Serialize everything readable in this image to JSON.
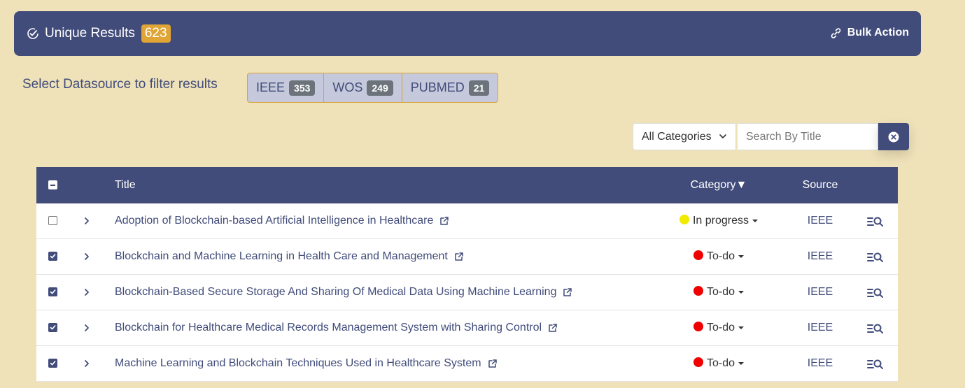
{
  "header": {
    "title": "Unique Results",
    "count": "623",
    "bulk_action_label": "Bulk Action"
  },
  "filter": {
    "label": "Select Datasource to filter results",
    "datasources": [
      {
        "name": "IEEE",
        "count": "353"
      },
      {
        "name": "WOS",
        "count": "249"
      },
      {
        "name": "PUBMED",
        "count": "21"
      }
    ]
  },
  "toolbar": {
    "category_select_value": "All Categories",
    "search_placeholder": "Search By Title"
  },
  "table": {
    "columns": {
      "title": "Title",
      "category": "Category▼",
      "source": "Source"
    },
    "rows": [
      {
        "checked": false,
        "title": "Adoption of Blockchain-based Artificial Intelligence in Healthcare",
        "category": "In progress",
        "status_color": "#f2ea00",
        "source": "IEEE"
      },
      {
        "checked": true,
        "title": "Blockchain and Machine Learning in Health Care and Management",
        "category": "To-do",
        "status_color": "#f00000",
        "source": "IEEE"
      },
      {
        "checked": true,
        "title": "Blockchain-Based Secure Storage And Sharing Of Medical Data Using Machine Learning",
        "category": "To-do",
        "status_color": "#f00000",
        "source": "IEEE"
      },
      {
        "checked": true,
        "title": "Blockchain for Healthcare Medical Records Management System with Sharing Control",
        "category": "To-do",
        "status_color": "#f00000",
        "source": "IEEE"
      },
      {
        "checked": true,
        "title": "Machine Learning and Blockchain Techniques Used in Healthcare System",
        "category": "To-do",
        "status_color": "#f00000",
        "source": "IEEE"
      }
    ]
  },
  "colors": {
    "background": "#efe2b9",
    "primary": "#414c7a",
    "accent": "#e0a535"
  }
}
